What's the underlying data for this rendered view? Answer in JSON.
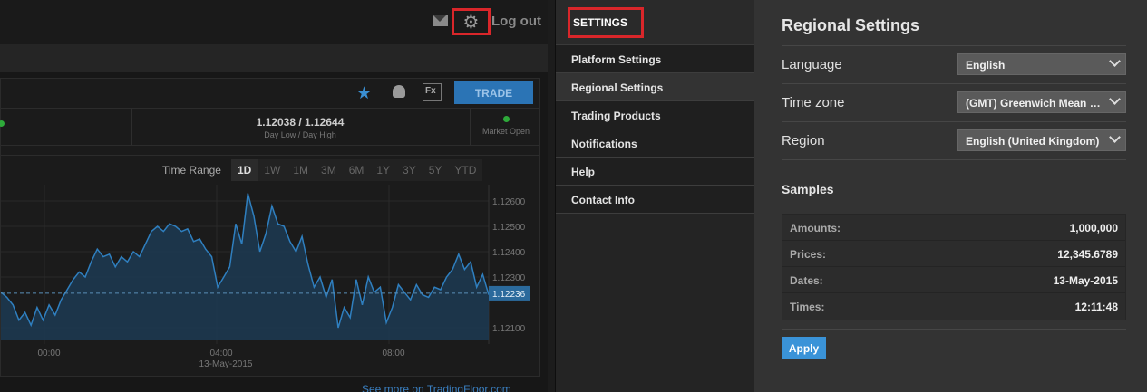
{
  "header": {
    "mail_icon": "mail-icon",
    "settings_icon": "gear-icon",
    "logout_label": "Log out",
    "highlight_color": "#d9262a"
  },
  "trade": {
    "trade_label": "TRADE",
    "day_range_value": "1.12038 / 1.12644",
    "day_range_label": "Day Low / Day High",
    "market_status": "Market Open"
  },
  "chart": {
    "time_range_label": "Time Range",
    "ranges": [
      "1D",
      "1W",
      "1M",
      "3M",
      "6M",
      "1Y",
      "3Y",
      "5Y",
      "YTD"
    ],
    "active_range": "1D",
    "see_more": "See more on TradingFloor.com"
  },
  "chart_data": {
    "type": "area",
    "x_ticks": [
      "00:00",
      "04:00",
      "08:00"
    ],
    "x_date": "13-May-2015",
    "y_ticks": [
      "1.12600",
      "1.12500",
      "1.12400",
      "1.12300",
      "1.12100"
    ],
    "ylim": [
      1.1205,
      1.1265
    ],
    "current_value": "1.12236",
    "values": [
      1.1224,
      1.1222,
      1.1219,
      1.1213,
      1.1216,
      1.1211,
      1.1218,
      1.1213,
      1.1219,
      1.1215,
      1.1221,
      1.1225,
      1.1229,
      1.1232,
      1.123,
      1.1236,
      1.1241,
      1.1238,
      1.1239,
      1.1234,
      1.1238,
      1.1236,
      1.124,
      1.1238,
      1.1243,
      1.1248,
      1.125,
      1.1248,
      1.1251,
      1.125,
      1.1248,
      1.1249,
      1.1244,
      1.1245,
      1.1241,
      1.1238,
      1.1226,
      1.123,
      1.1234,
      1.1251,
      1.1243,
      1.1263,
      1.1254,
      1.124,
      1.1247,
      1.1258,
      1.1251,
      1.125,
      1.1244,
      1.124,
      1.1246,
      1.1235,
      1.1226,
      1.123,
      1.1222,
      1.1229,
      1.121,
      1.1218,
      1.1214,
      1.1229,
      1.1219,
      1.123,
      1.1224,
      1.1226,
      1.1212,
      1.1218,
      1.1227,
      1.1224,
      1.1221,
      1.1227,
      1.1223,
      1.1222,
      1.1226,
      1.1225,
      1.123,
      1.1233,
      1.1239,
      1.1233,
      1.1236,
      1.1226,
      1.1231,
      1.1223
    ],
    "line_color": "#2f7fbf",
    "fill_color": "#1c3a52",
    "grid": true
  },
  "settings_menu": {
    "title": "SETTINGS",
    "items": [
      {
        "label": "Platform Settings"
      },
      {
        "label": "Regional Settings"
      },
      {
        "label": "Trading Products"
      },
      {
        "label": "Notifications"
      },
      {
        "label": "Help"
      },
      {
        "label": "Contact Info"
      }
    ],
    "active": "Regional Settings"
  },
  "regional": {
    "title": "Regional Settings",
    "language_label": "Language",
    "language_value": "English",
    "timezone_label": "Time zone",
    "timezone_value": "(GMT) Greenwich Mean Time",
    "region_label": "Region",
    "region_value": "English (United Kingdom)",
    "samples_title": "Samples",
    "samples": [
      {
        "key": "Amounts:",
        "value": "1,000,000"
      },
      {
        "key": "Prices:",
        "value": "12,345.6789"
      },
      {
        "key": "Dates:",
        "value": "13-May-2015"
      },
      {
        "key": "Times:",
        "value": "12:11:48"
      }
    ],
    "apply_label": "Apply",
    "accent_color": "#3a93d8"
  }
}
